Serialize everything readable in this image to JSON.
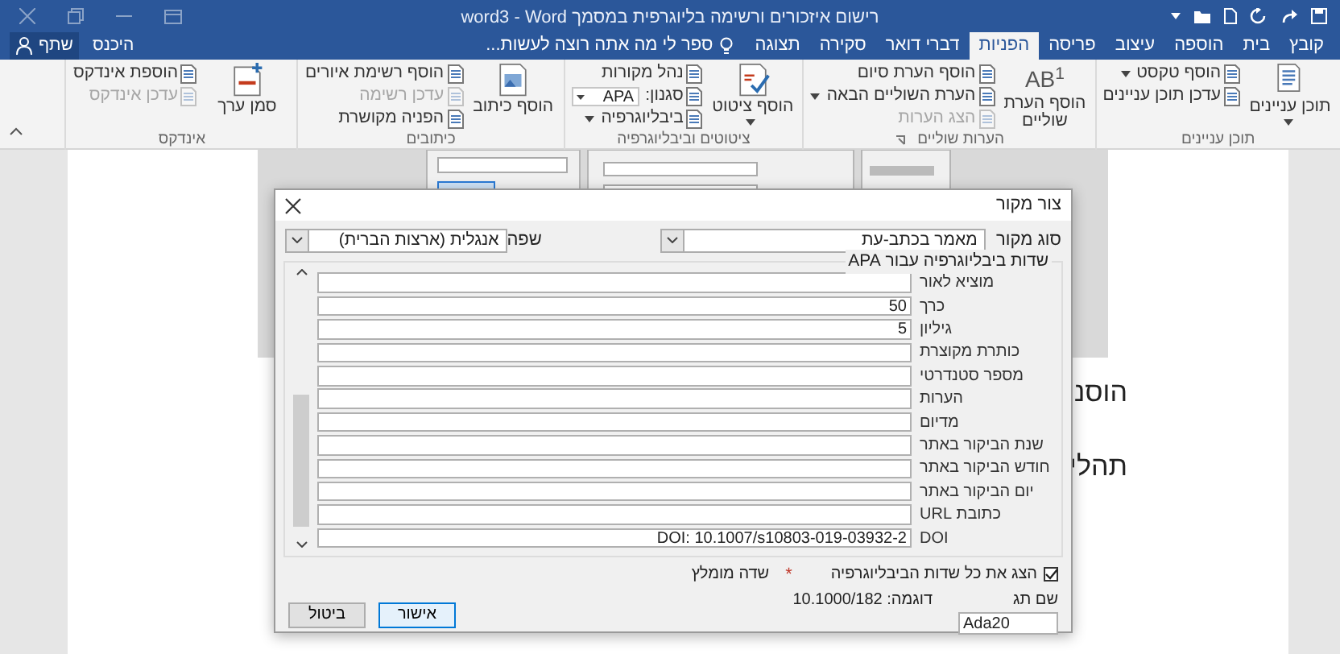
{
  "window": {
    "title": "רישום איזכורים ורשימה בליוגרפית במסמך word3 - Word"
  },
  "tabs": [
    {
      "label": "קובץ",
      "selected": false
    },
    {
      "label": "בית",
      "selected": false
    },
    {
      "label": "הוספה",
      "selected": false
    },
    {
      "label": "עיצוב",
      "selected": false
    },
    {
      "label": "פריסה",
      "selected": false
    },
    {
      "label": "הפניות",
      "selected": true
    },
    {
      "label": "דברי דואר",
      "selected": false
    },
    {
      "label": "סקירה",
      "selected": false
    },
    {
      "label": "תצוגה",
      "selected": false
    }
  ],
  "tell_me": "ספר לי מה אתה רוצה לעשות...",
  "sign_in": "היכנס",
  "share": "שתף",
  "ribbon_groups": [
    {
      "label": "תוכן עניינים",
      "kind": "toc",
      "large": {
        "label": "תוכן עניינים",
        "dropdown": true
      },
      "small": [
        {
          "label": "הוסף טקסט",
          "dropdown": true,
          "disabled": false
        },
        {
          "label": "עדכן תוכן עניינים",
          "dropdown": false,
          "disabled": false
        }
      ]
    },
    {
      "label": "הערות שוליים",
      "kind": "footnote",
      "launcher": true,
      "icon_text": "AB$^{1}$",
      "large": {
        "label": "הוסף הערת שוליים",
        "dropdown": false
      },
      "small": [
        {
          "label": "הוסף הערת סיום",
          "dropdown": false,
          "disabled": false
        },
        {
          "label": "הערת השוליים הבאה",
          "dropdown": true,
          "disabled": false
        },
        {
          "label": "הצג הערות",
          "dropdown": false,
          "disabled": true
        }
      ]
    },
    {
      "label": "ציטוטים וביבליוגרפיה",
      "kind": "citation",
      "large": {
        "label": "הוסף ציטוט",
        "dropdown": true
      },
      "small": [
        {
          "label": "נהל מקורות",
          "dropdown": false,
          "disabled": false
        },
        {
          "label": "סגנון:",
          "dropdown": false,
          "disabled": false,
          "combo": "APA"
        },
        {
          "label": "ביבליוגרפיה",
          "dropdown": true,
          "disabled": false
        }
      ]
    },
    {
      "label": "כיתובים",
      "kind": "caption",
      "large": {
        "label": "הוסף כיתוב",
        "dropdown": false
      },
      "small": [
        {
          "label": "הוסף רשימת איורים",
          "dropdown": false,
          "disabled": false
        },
        {
          "label": "עדכן רשימה",
          "dropdown": false,
          "disabled": true
        },
        {
          "label": "הפניה מקושרת",
          "dropdown": false,
          "disabled": false
        }
      ]
    },
    {
      "label": "אינדקס",
      "kind": "index",
      "large": {
        "label": "סמן ערך",
        "dropdown": false
      },
      "small": [
        {
          "label": "הוספת אינדקס",
          "dropdown": false,
          "disabled": false
        },
        {
          "label": "עדכן אינדקס",
          "dropdown": false,
          "disabled": true
        }
      ]
    }
  ],
  "document": {
    "lines": [
      "הוסנ",
      "תהלי"
    ]
  },
  "dialog": {
    "title": "צור מקור",
    "source_type": {
      "label": "סוג מקור",
      "value": "מאמר בכתב-עת"
    },
    "language": {
      "label": "שפה",
      "value": "אנגלית (ארצות הברית)"
    },
    "fields_legend": "שדות ביבליוגרפיה עבור APA",
    "fields": [
      {
        "label": "מוציא לאור"
      },
      {
        "label": "כרך",
        "value": "50"
      },
      {
        "label": "גיליון",
        "value": "5"
      },
      {
        "label": "כותרת מקוצרת"
      },
      {
        "label": "מספר סטנדרטי"
      },
      {
        "label": "הערות"
      },
      {
        "label": "מדיום"
      },
      {
        "label": "שנת הביקור באתר"
      },
      {
        "label": "חודש הביקור באתר"
      },
      {
        "label": "יום הביקור באתר"
      },
      {
        "label": "כתובת URL"
      },
      {
        "label": "DOI",
        "value": "DOI: 10.1007/s10803-019-03932-2"
      }
    ],
    "show_all": {
      "label": "הצג את כל שדות הביבליוגרפיה",
      "checked": true
    },
    "recommended_mark": "*",
    "recommended": "שדה מומלץ",
    "tag": {
      "label": "שם תג",
      "value": "Ada20"
    },
    "example": "דוגמה: 10.1000/182",
    "buttons": [
      {
        "label": "אישור",
        "default": true
      },
      {
        "label": "ביטול",
        "default": false
      }
    ]
  }
}
